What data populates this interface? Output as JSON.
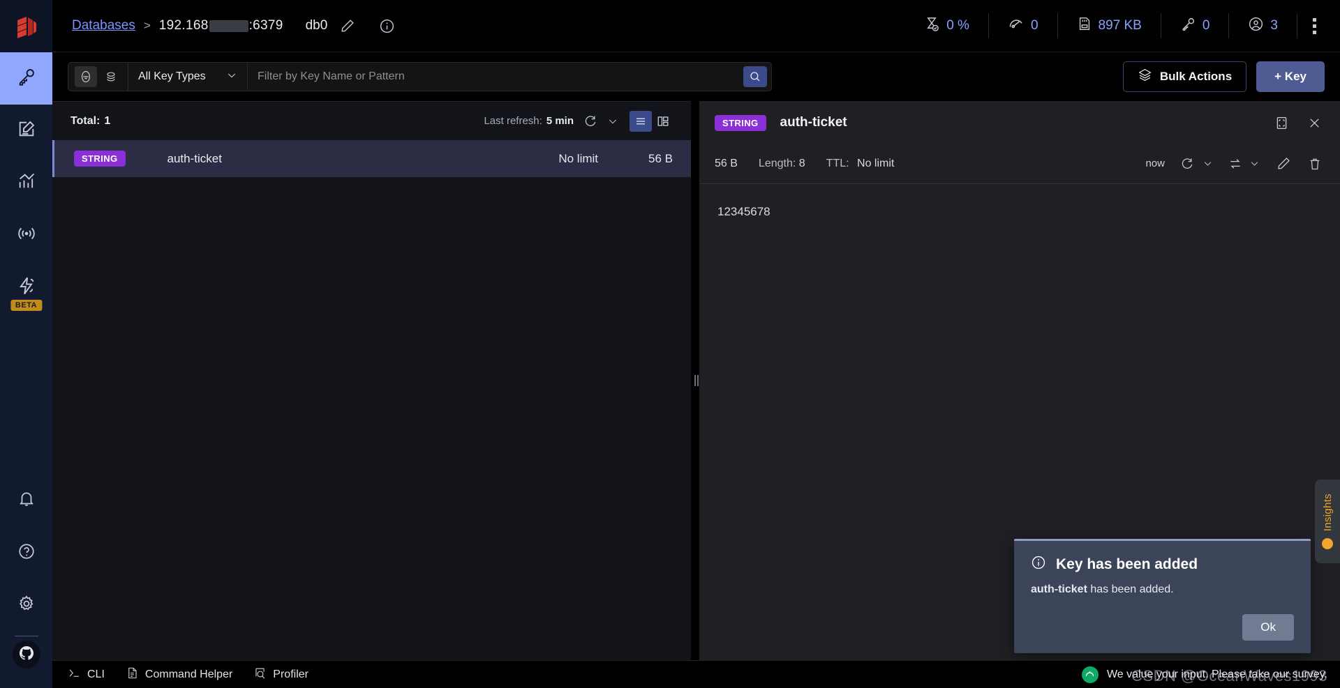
{
  "sidebar": {
    "logo": "redis-logo",
    "items": [
      {
        "name": "browser",
        "icon": "key-icon",
        "active": true
      },
      {
        "name": "workbench",
        "icon": "edit-document-icon",
        "active": false
      },
      {
        "name": "analysis-tools",
        "icon": "bar-chart-icon",
        "active": false
      },
      {
        "name": "pub-sub",
        "icon": "broadcast-icon",
        "active": false
      },
      {
        "name": "triggers-and-functions",
        "icon": "lightning-icon",
        "active": false,
        "badge": "BETA"
      }
    ],
    "bottom_items": [
      {
        "name": "notifications",
        "icon": "bell-icon"
      },
      {
        "name": "help",
        "icon": "question-circle-icon"
      },
      {
        "name": "settings",
        "icon": "gear-icon"
      },
      {
        "name": "github",
        "icon": "github-icon"
      }
    ]
  },
  "header": {
    "breadcrumb_link": "Databases",
    "breadcrumb_separator": ">",
    "host_prefix": "192.168",
    "host_suffix": ":6379",
    "database": "db0",
    "edit_icon": "pencil-icon",
    "info_icon": "info-circle-icon",
    "stats": [
      {
        "name": "cpu",
        "icon": "hourglass-check-icon",
        "value": "0 %"
      },
      {
        "name": "commands-per-second",
        "icon": "speedometer-icon",
        "value": "0"
      },
      {
        "name": "memory-used",
        "icon": "memory-card-icon",
        "value": "897 KB"
      },
      {
        "name": "total-keys",
        "icon": "key-icon",
        "value": "0"
      },
      {
        "name": "connected-clients",
        "icon": "user-circle-icon",
        "value": "3"
      }
    ],
    "overflow_icon": "kebab-menu-icon"
  },
  "toolbar": {
    "filter_icon": "filter-icon",
    "scan_icon": "layers-scan-icon",
    "key_type_selected": "All Key Types",
    "chevron_icon": "chevron-down-icon",
    "search_placeholder": "Filter by Key Name or Pattern",
    "search_value": "",
    "search_button_icon": "search-icon",
    "bulk_actions_label": "Bulk Actions",
    "bulk_actions_icon": "layers-icon",
    "add_key_label": "+ Key"
  },
  "keys_panel": {
    "total_label": "Total:",
    "total_value": "1",
    "last_refresh_label": "Last refresh:",
    "last_refresh_value": "5 min",
    "refresh_icon": "refresh-icon",
    "refresh_chevron_icon": "chevron-down-icon",
    "view_list_icon": "list-view-icon",
    "view_tree_icon": "tree-view-icon",
    "view_selected": "list",
    "rows": [
      {
        "type": "STRING",
        "name": "auth-ticket",
        "ttl": "No limit",
        "size": "56 B",
        "selected": true
      }
    ]
  },
  "details": {
    "type_badge": "STRING",
    "key_name": "auth-ticket",
    "fullscreen_icon": "expand-icon",
    "close_icon": "close-icon",
    "size": "56 B",
    "length_label": "Length:",
    "length_value": "8",
    "ttl_label": "TTL:",
    "ttl_value": "No limit",
    "refresh_time": "now",
    "refresh_icon": "refresh-icon",
    "refresh_chevron_icon": "chevron-down-icon",
    "format_icon": "swap-format-icon",
    "format_chevron_icon": "chevron-down-icon",
    "edit_icon": "pencil-icon",
    "delete_icon": "trash-icon",
    "value": "12345678"
  },
  "toast": {
    "info_icon": "info-circle-icon",
    "title": "Key has been added",
    "message_key": "auth-ticket",
    "message_rest": " has been added.",
    "ok_label": "Ok"
  },
  "insights": {
    "label": "Insights",
    "icon": "lightbulb-icon"
  },
  "bottombar": {
    "cli_label": "CLI",
    "cli_icon": "terminal-icon",
    "command_helper_label": "Command Helper",
    "command_helper_icon": "document-icon",
    "profiler_label": "Profiler",
    "profiler_icon": "profiler-search-icon",
    "survey_text": "We value your input. Please take our survey.",
    "survey_icon": "survey-icon"
  },
  "watermark": {
    "text": "CSDN @OceanWaves1993"
  },
  "colors": {
    "accent_purple": "#8b2fd6",
    "accent_blue": "#7b93ff",
    "sidebar_bg": "#111a2e",
    "panel_bg": "#13131a",
    "details_bg": "#1f1f24",
    "selected_row": "#2c2c44",
    "primary_button": "#4f5b93",
    "insights_orange": "#efa32a"
  }
}
